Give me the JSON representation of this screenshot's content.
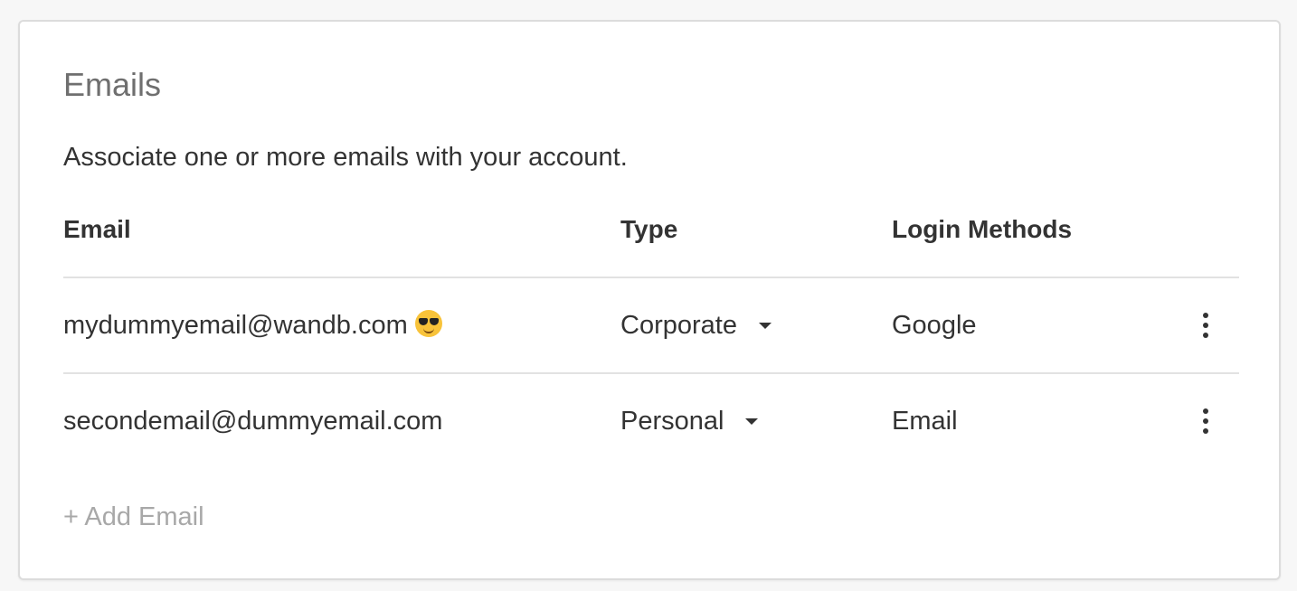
{
  "card": {
    "title": "Emails",
    "description": "Associate one or more emails with your account."
  },
  "table": {
    "headers": {
      "email": "Email",
      "type": "Type",
      "login_methods": "Login Methods"
    },
    "rows": [
      {
        "email": "mydummyemail@wandb.com",
        "badge_icon": "sunglasses-emoji-icon",
        "type": "Corporate",
        "login_method": "Google",
        "login_color": "#1a1a1a"
      },
      {
        "email": "secondemail@dummyemail.com",
        "type": "Personal",
        "login_method": "Email",
        "login_color": "#e0001b"
      }
    ]
  },
  "add_email_label": "+ Add Email",
  "colors": {
    "background": "#f7f7f7",
    "card": "#ffffff",
    "warning": "#e0001b",
    "muted": "#a8a8a8"
  }
}
